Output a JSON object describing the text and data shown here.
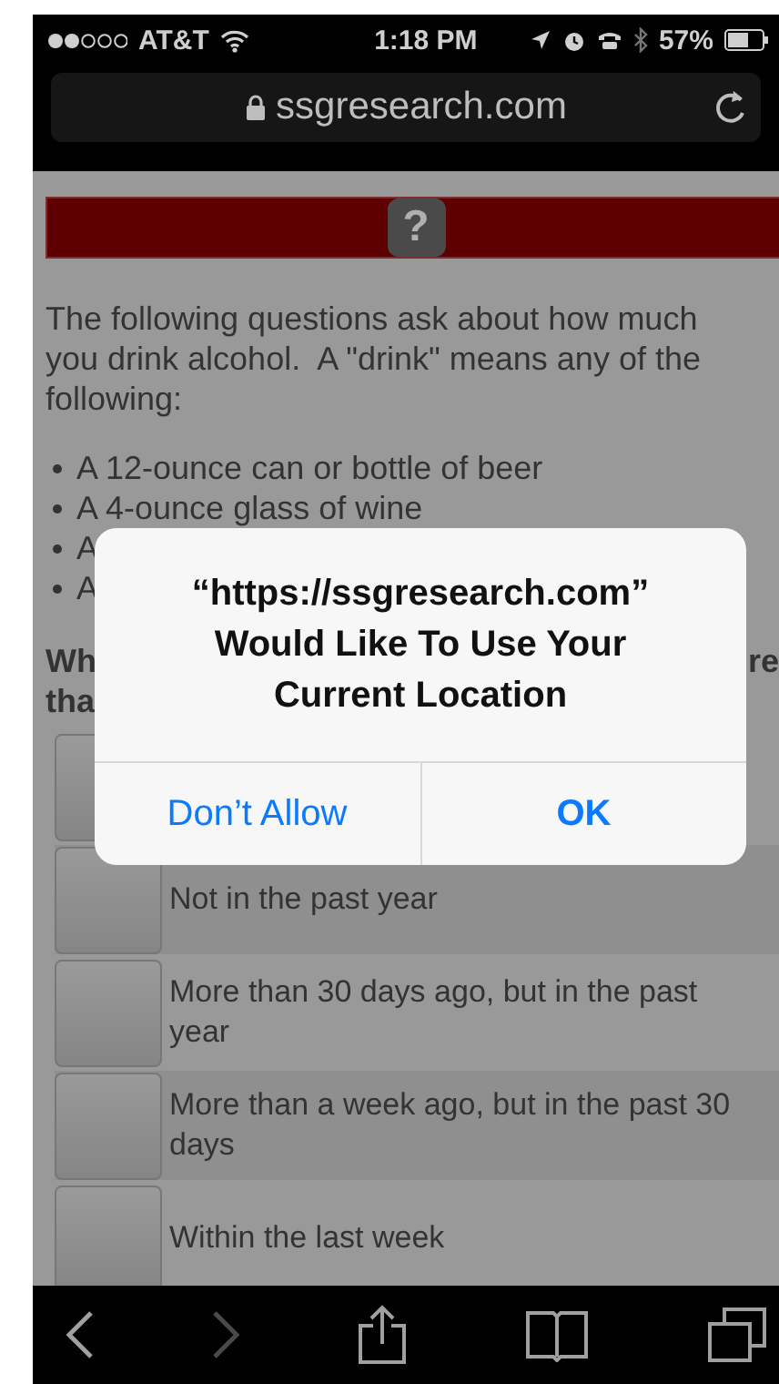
{
  "status_bar": {
    "carrier": "AT&T",
    "time": "1:18 PM",
    "battery": "57%"
  },
  "address_bar": {
    "url": "ssgresearch.com"
  },
  "header": {
    "icon_text": "?"
  },
  "intro": "The following questions ask about how much you drink alcohol.  A \"drink\" means any of the following:",
  "bullets": [
    "A 12-ounce can or bottle of beer",
    "A 4-ounce glass of wine",
    "A",
    "A"
  ],
  "question": {
    "line1_start": "Wh",
    "line1_end": "re",
    "line2_start": "tha"
  },
  "options": [
    {
      "kind": "covered",
      "selected": false
    },
    {
      "kind": "text",
      "label": "Not in the past year",
      "selected": false
    },
    {
      "kind": "text",
      "label": "More than 30 days ago, but in the past year",
      "selected": false
    },
    {
      "kind": "text",
      "label": "More than a week ago, but in the past 30 days",
      "selected": false
    },
    {
      "kind": "text",
      "label": "Within the last week",
      "selected": false
    }
  ],
  "dialog": {
    "title_lines": [
      "“https://ssgresearch.com”",
      "Would Like To Use Your",
      "Current Location"
    ],
    "buttons": [
      {
        "label": "Don’t Allow",
        "kind": "cancel"
      },
      {
        "label": "OK",
        "kind": "default"
      }
    ]
  },
  "toolbar": {
    "back_enabled": true,
    "forward_enabled": false
  }
}
